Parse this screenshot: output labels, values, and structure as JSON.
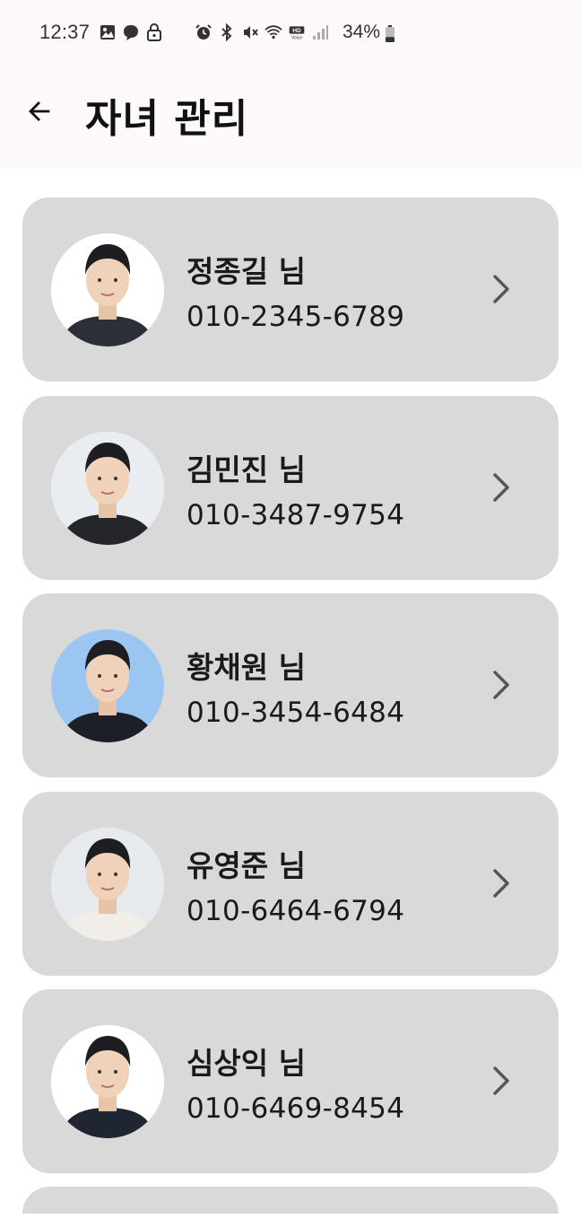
{
  "status_bar": {
    "time": "12:37",
    "battery_percent": "34%",
    "icons_left": [
      "gallery-icon",
      "chat-bubble-icon",
      "lock-icon"
    ],
    "icons_right": [
      "alarm-icon",
      "bluetooth-icon",
      "mute-icon",
      "wifi-icon",
      "hd-voice-icon",
      "signal-icon"
    ],
    "battery_level": 0.34
  },
  "header": {
    "title": "자녀 관리",
    "back_icon": "arrow-left-icon"
  },
  "children": [
    {
      "name": "정종길 님",
      "phone": "010-2345-6789",
      "avatar_bg": "#ffffff",
      "shirt": "#2b2f38"
    },
    {
      "name": "김민진 님",
      "phone": "010-3487-9754",
      "avatar_bg": "#e9ecf0",
      "shirt": "#24262b"
    },
    {
      "name": "황채원 님",
      "phone": "010-3454-6484",
      "avatar_bg": "#9cc6f2",
      "shirt": "#1d1f26"
    },
    {
      "name": "유영준 님",
      "phone": "010-6464-6794",
      "avatar_bg": "#e6e9ee",
      "shirt": "#f1eeea"
    },
    {
      "name": "심상익 님",
      "phone": "010-6469-8454",
      "avatar_bg": "#ffffff",
      "shirt": "#1f2533"
    }
  ],
  "colors": {
    "card_bg": "#d9d9d9",
    "appbar_bg": "#fdf8fb",
    "text": "#1a1a1a"
  }
}
